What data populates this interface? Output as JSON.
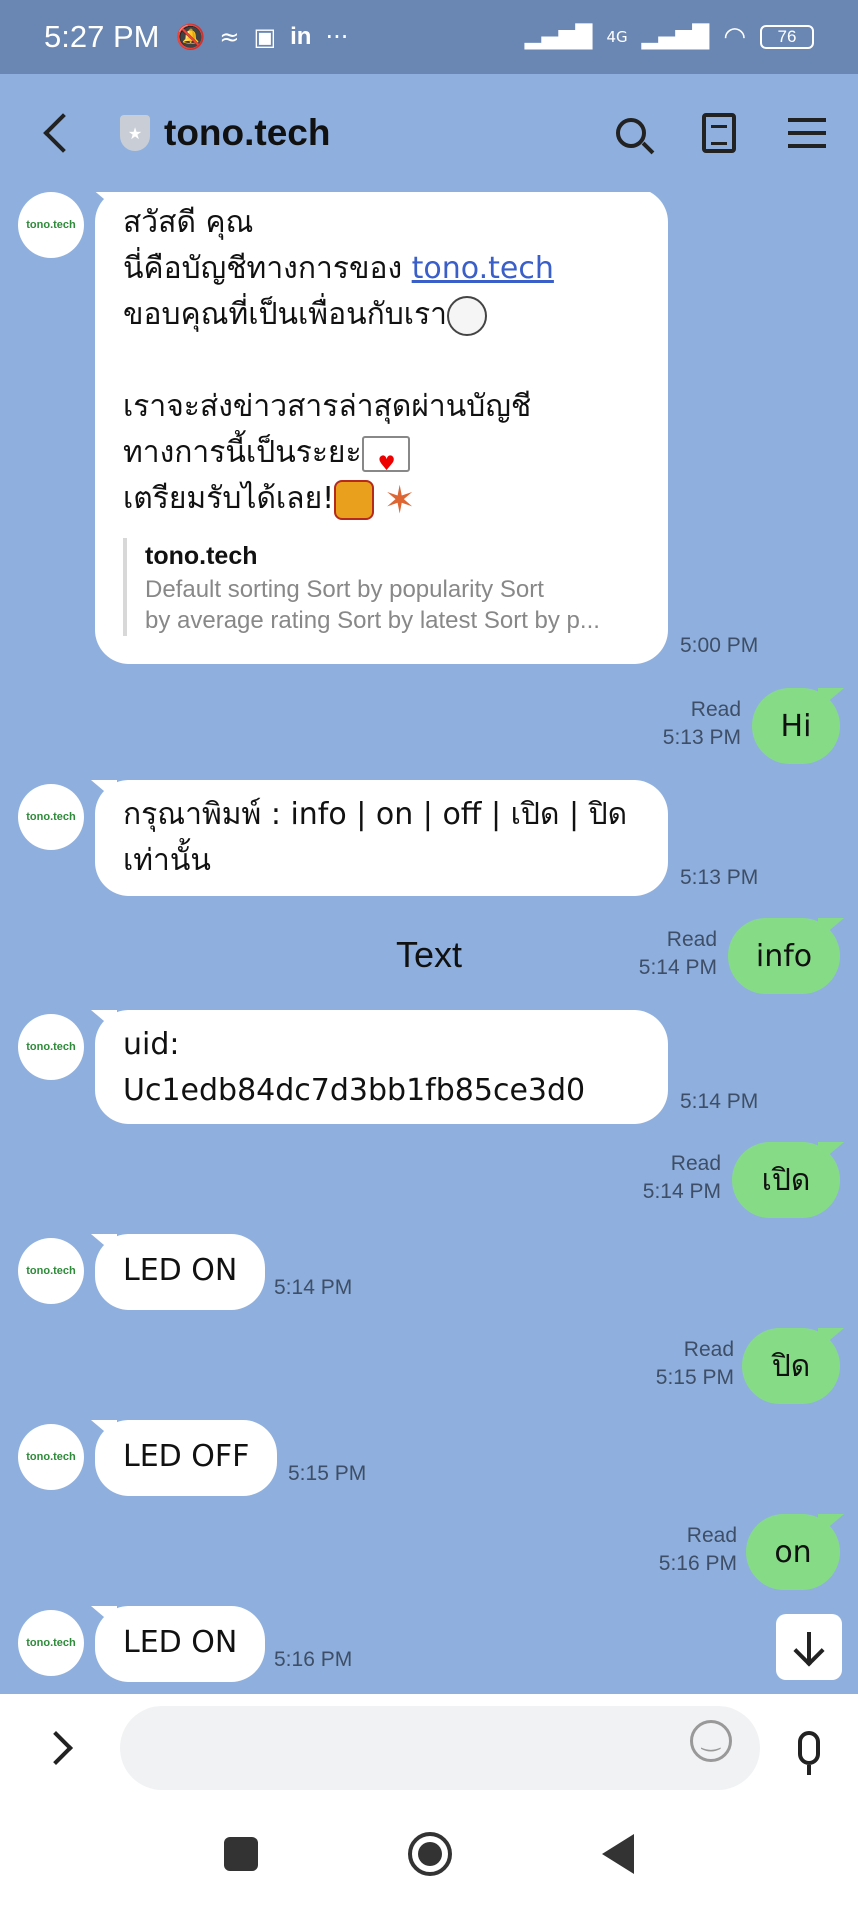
{
  "status_bar": {
    "time": "5:27 PM",
    "notification_icons": [
      "mute-icon",
      "data-icon",
      "shop-icon",
      "linkedin-icon",
      "more-icon"
    ],
    "network_label": "4G",
    "battery": "76"
  },
  "header": {
    "title": "tono.tech"
  },
  "avatar_label": "tono.tech",
  "messages": {
    "welcome": {
      "line1": "สวัสดี คุณ",
      "line2_prefix": "นี่คือบัญชีทางการของ ",
      "line2_link": "tono.tech",
      "line3": "ขอบคุณที่เป็นเพื่อนกับเรา",
      "line4": "เราจะส่งข่าวสารล่าสุดผ่านบัญชี",
      "line5": "ทางการนี้เป็นระยะ",
      "line6": "เตรียมรับได้เลย!",
      "preview_title": "tono.tech",
      "preview_line1": "Default sorting Sort by popularity Sort",
      "preview_line2": "by average rating Sort by latest Sort by p...",
      "time": "5:00 PM"
    },
    "hi": {
      "text": "Hi",
      "read": "Read",
      "time": "5:13 PM"
    },
    "prompt": {
      "line1": "กรุณาพิมพ์ : info | on | off | เปิด | ปิด",
      "line2": "เท่านั้น",
      "time": "5:13 PM"
    },
    "center_label": "Text",
    "info": {
      "text": "info",
      "read": "Read",
      "time": "5:14 PM"
    },
    "uid": {
      "text": "uid: Uc1edb84dc7d3bb1fb85ce3d0",
      "time": "5:14 PM"
    },
    "open": {
      "text": "เปิด",
      "read": "Read",
      "time": "5:14 PM"
    },
    "led_on_1": {
      "text": "LED ON",
      "time": "5:14 PM"
    },
    "close": {
      "text": "ปิด",
      "read": "Read",
      "time": "5:15 PM"
    },
    "led_off": {
      "text": "LED OFF",
      "time": "5:15 PM"
    },
    "on": {
      "text": "on",
      "read": "Read",
      "time": "5:16 PM"
    },
    "led_on_2": {
      "text": "LED ON",
      "time": "5:16 PM"
    }
  },
  "colors": {
    "chat_bg": "#8fb0de",
    "outgoing_bubble": "#86dc86",
    "incoming_bubble": "#ffffff",
    "status_bar": "#6a87b3"
  }
}
